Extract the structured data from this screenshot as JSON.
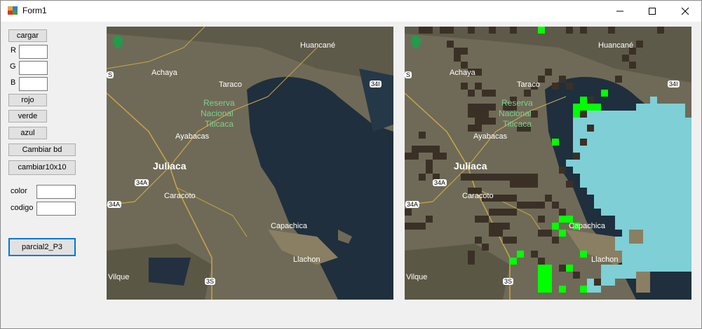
{
  "window": {
    "title": "Form1"
  },
  "controls": {
    "cargar": "cargar",
    "r_label": "R",
    "g_label": "G",
    "b_label": "B",
    "r_value": "",
    "g_value": "",
    "b_value": "",
    "rojo": "rojo",
    "verde": "verde",
    "azul": "azul",
    "cambiar_bd": "Cambiar bd",
    "cambiar10x10": "cambiar10x10",
    "color_label": "color",
    "codigo_label": "codigo",
    "color_value": "",
    "codigo_value": "",
    "parcial": "parcial2_P3"
  },
  "map_labels": {
    "huancane": "Huancané",
    "achaya": "Achaya",
    "taraco": "Taraco",
    "reserva1": "Reserva",
    "reserva2": "Nacional",
    "reserva3": "Titicaca",
    "ayabacas": "Ayabacas",
    "juliaca": "Juliaca",
    "caracoto": "Caracoto",
    "capachica": "Capachica",
    "llachon": "Llachon",
    "vilque": "Vilque",
    "r34a": "34A",
    "r34i": "34I",
    "r3s": "3S",
    "s": "S"
  },
  "colors": {
    "overlay_green": "#00ff00",
    "overlay_cyan": "#7ecfd6",
    "overlay_brown": "#3b3026"
  }
}
